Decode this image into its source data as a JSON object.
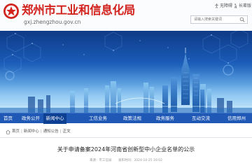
{
  "header": {
    "site_title": "郑州市工业和信息化局",
    "site_domain": "gxj.zhengzhou.gov.cn",
    "logo": "zhengzhou-emblem-icon",
    "utility": {
      "items": [
        {
          "icon": "accessibility-icon",
          "label": "无障碍"
        },
        {
          "icon": "elderly-mode-icon",
          "label": "长辈版"
        }
      ]
    },
    "search": {
      "placeholder": "请输入搜索关键词",
      "icon": "search-icon"
    }
  },
  "banner": {
    "theme_color": "#1a5bb7"
  },
  "nav": {
    "items": [
      {
        "label": "首页"
      },
      {
        "label": "政务公开"
      },
      {
        "label": "新闻中心",
        "active": true
      },
      {
        "label": "工信业务"
      },
      {
        "label": "政策法规"
      },
      {
        "label": "政务服务"
      },
      {
        "label": "互动交流"
      },
      {
        "label": "信用郑州"
      }
    ],
    "color": "#2058b6",
    "active_color": "#0d3f93"
  },
  "breadcrumb": {
    "items": [
      "首页",
      "新闻中心",
      "通知公告"
    ],
    "current": "正文"
  },
  "article": {
    "title": "关于申请备案2024年河南省创新型中小企业名单的公示",
    "meta": {
      "source": "来源：",
      "source_value": "市工信局",
      "date_label": "发布时间：",
      "date_value": "2024-10-25 16:02"
    }
  }
}
